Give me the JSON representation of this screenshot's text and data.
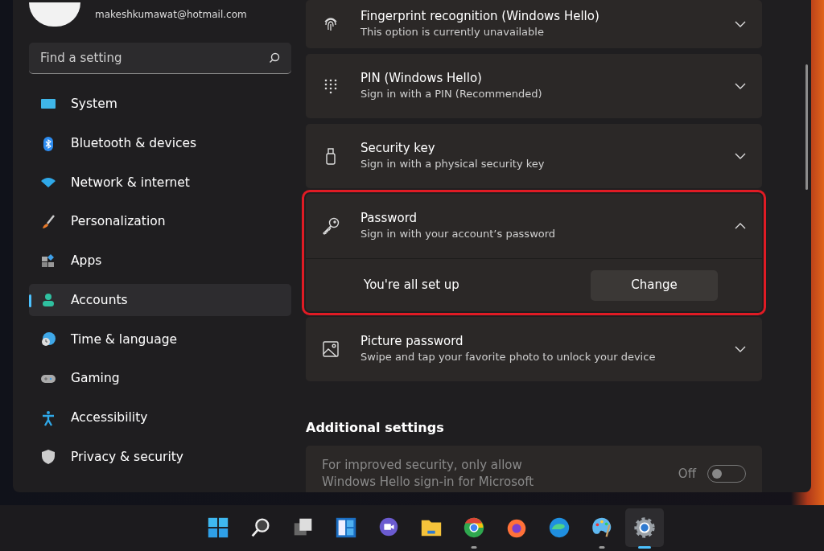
{
  "account": {
    "email": "makeshkumawat@hotmail.com"
  },
  "search": {
    "placeholder": "Find a setting"
  },
  "nav": [
    {
      "label": "System",
      "kind": "system",
      "selected": false
    },
    {
      "label": "Bluetooth & devices",
      "kind": "bluetooth",
      "selected": false
    },
    {
      "label": "Network & internet",
      "kind": "wifi",
      "selected": false
    },
    {
      "label": "Personalization",
      "kind": "brush",
      "selected": false
    },
    {
      "label": "Apps",
      "kind": "apps",
      "selected": false
    },
    {
      "label": "Accounts",
      "kind": "person",
      "selected": true
    },
    {
      "label": "Time & language",
      "kind": "clock",
      "selected": false
    },
    {
      "label": "Gaming",
      "kind": "gamepad",
      "selected": false
    },
    {
      "label": "Accessibility",
      "kind": "accessibility",
      "selected": false
    },
    {
      "label": "Privacy & security",
      "kind": "shield",
      "selected": false
    }
  ],
  "sign_in_options": [
    {
      "kind": "fingerprint",
      "title": "Fingerprint recognition (Windows Hello)",
      "subtitle": "This option is currently unavailable",
      "expanded": false,
      "highlighted": false
    },
    {
      "kind": "dots",
      "title": "PIN (Windows Hello)",
      "subtitle": "Sign in with a PIN (Recommended)",
      "expanded": false,
      "highlighted": false
    },
    {
      "kind": "usbkey",
      "title": "Security key",
      "subtitle": "Sign in with a physical security key",
      "expanded": false,
      "highlighted": false
    },
    {
      "kind": "key",
      "title": "Password",
      "subtitle": "Sign in with your account’s password",
      "expanded": true,
      "highlighted": true,
      "detail": "You're all set up",
      "button": "Change"
    },
    {
      "kind": "picture",
      "title": "Picture password",
      "subtitle": "Swipe and tap your favorite photo to unlock your device",
      "expanded": false,
      "highlighted": false
    }
  ],
  "additional_settings": {
    "heading": "Additional settings",
    "option": {
      "label": "For improved security, only allow Windows Hello sign-in for Microsoft",
      "state_label": "Off",
      "on": false,
      "disabled": true
    }
  },
  "taskbar": [
    {
      "kind": "start",
      "running": false,
      "active": false
    },
    {
      "kind": "search",
      "running": false,
      "active": false
    },
    {
      "kind": "taskview",
      "running": false,
      "active": false
    },
    {
      "kind": "widgets",
      "running": false,
      "active": false
    },
    {
      "kind": "chat",
      "running": false,
      "active": false
    },
    {
      "kind": "folder",
      "running": false,
      "active": false
    },
    {
      "kind": "chrome",
      "running": true,
      "active": false
    },
    {
      "kind": "firefox",
      "running": false,
      "active": false
    },
    {
      "kind": "edge",
      "running": false,
      "active": false
    },
    {
      "kind": "paint",
      "running": true,
      "active": false
    },
    {
      "kind": "settings",
      "running": true,
      "active": true
    }
  ]
}
